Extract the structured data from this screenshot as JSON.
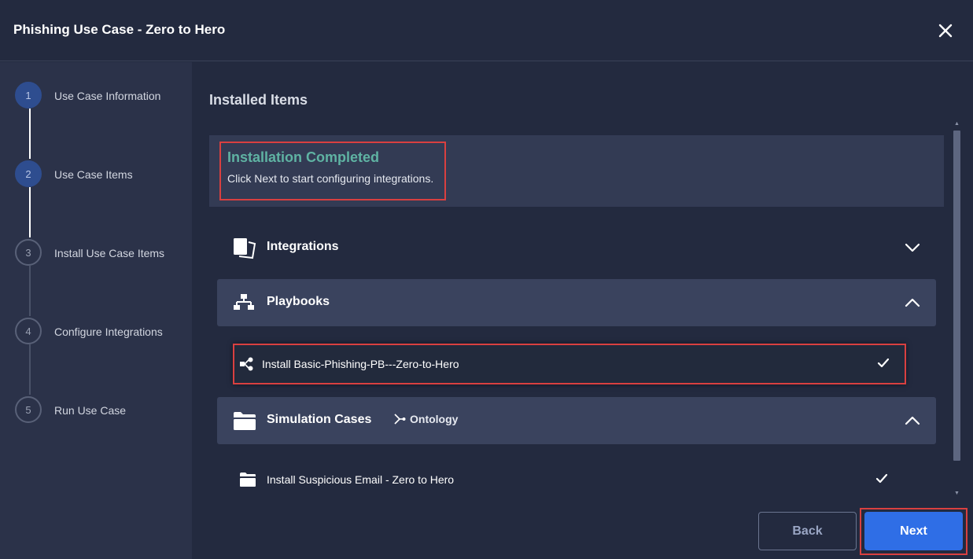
{
  "window": {
    "title": "Phishing Use Case - Zero to Hero",
    "close_icon": "close-icon"
  },
  "steps": [
    {
      "number": "1",
      "label": "Use Case Information",
      "state": "done"
    },
    {
      "number": "2",
      "label": "Use Case Items",
      "state": "current"
    },
    {
      "number": "3",
      "label": "Install Use Case Items",
      "state": "pending"
    },
    {
      "number": "4",
      "label": "Configure Integrations",
      "state": "pending"
    },
    {
      "number": "5",
      "label": "Run Use Case",
      "state": "pending"
    }
  ],
  "main": {
    "title": "Installed Items",
    "banner": {
      "title": "Installation Completed",
      "subtitle": "Click Next to start configuring integrations."
    },
    "sections": {
      "integrations": {
        "label": "Integrations",
        "icon": "integrations-icon",
        "expanded": false
      },
      "playbooks": {
        "label": "Playbooks",
        "icon": "playbook-icon",
        "expanded": true
      },
      "simulation": {
        "label": "Simulation Cases",
        "icon": "folder-icon",
        "expanded": true,
        "ontology_label": "Ontology"
      }
    },
    "items": {
      "playbook_item": {
        "label": "Install Basic-Phishing-PB---Zero-to-Hero",
        "status": "installed"
      },
      "simulation_item": {
        "label": "Install Suspicious Email - Zero to Hero",
        "status": "installed"
      }
    }
  },
  "footer": {
    "back_label": "Back",
    "next_label": "Next"
  },
  "colors": {
    "accent": "#2f6ee6",
    "success_title": "#5fb3a3",
    "highlight_border": "#d94040",
    "step_done": "#2e4d8f"
  }
}
